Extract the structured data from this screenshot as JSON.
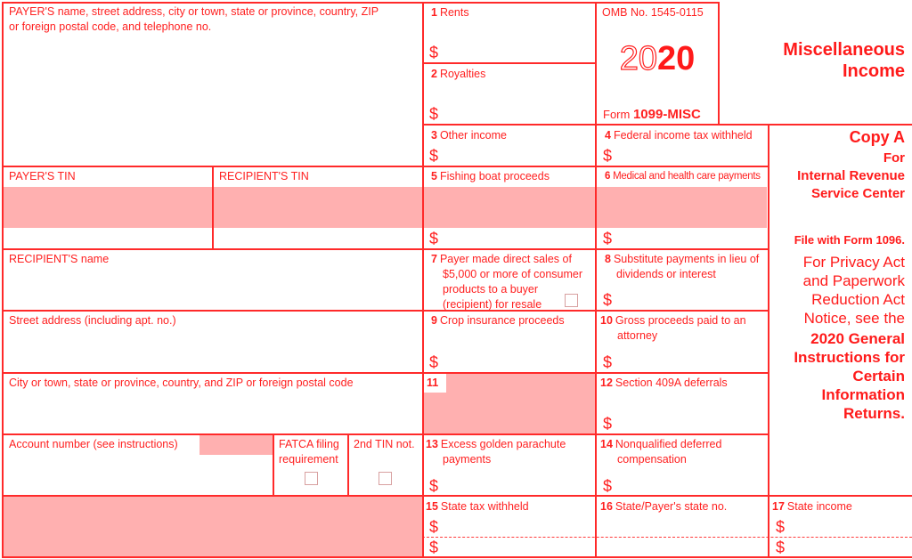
{
  "form": {
    "omb": "OMB No. 1545-0115",
    "year_outline": "20",
    "year_solid": "20",
    "form_prefix": "Form",
    "form_name": "1099-MISC",
    "title_line1": "Miscellaneous",
    "title_line2": "Income",
    "copy": "Copy A",
    "for_line1": "For",
    "for_line2": "Internal Revenue",
    "for_line3": "Service Center",
    "file_with": "File with Form 1096.",
    "privacy_lines": [
      "For Privacy Act",
      "and Paperwork",
      "Reduction Act",
      "Notice, see the"
    ],
    "instructions_lines": [
      "2020 General",
      "Instructions for",
      "Certain",
      "Information",
      "Returns."
    ],
    "colors": {
      "accent": "#ff1a1a",
      "shade": "#ffb0b0"
    }
  },
  "left": {
    "payer_name_l1": "PAYER'S name, street address, city or town, state or province, country, ZIP",
    "payer_name_l2": "or foreign postal code, and telephone no.",
    "payer_tin": "PAYER'S TIN",
    "recipient_tin": "RECIPIENT'S TIN",
    "recipient_name": "RECIPIENT'S name",
    "street": "Street address (including apt. no.)",
    "city": "City or town, state or province, country, and ZIP or foreign postal code",
    "account": "Account number (see instructions)",
    "fatca_l1": "FATCA filing",
    "fatca_l2": "requirement",
    "second_tin": "2nd TIN not."
  },
  "boxes": {
    "b1": {
      "num": "1",
      "label": "Rents"
    },
    "b2": {
      "num": "2",
      "label": "Royalties"
    },
    "b3": {
      "num": "3",
      "label": "Other income"
    },
    "b4": {
      "num": "4",
      "label": "Federal income tax withheld"
    },
    "b5": {
      "num": "5",
      "label": "Fishing boat proceeds"
    },
    "b6": {
      "num": "6",
      "label": "Medical and health care payments"
    },
    "b7": {
      "num": "7",
      "l1": "Payer made direct sales of",
      "l2": "$5,000 or more of consumer",
      "l3": "products to a buyer",
      "l4": "(recipient) for resale"
    },
    "b8": {
      "num": "8",
      "l1": "Substitute payments in lieu of",
      "l2": "dividends or interest"
    },
    "b9": {
      "num": "9",
      "label": "Crop insurance proceeds"
    },
    "b10": {
      "num": "10",
      "l1": "Gross proceeds paid to an",
      "l2": "attorney"
    },
    "b11": {
      "num": "11"
    },
    "b12": {
      "num": "12",
      "label": "Section 409A deferrals"
    },
    "b13": {
      "num": "13",
      "l1": "Excess golden parachute",
      "l2": "payments"
    },
    "b14": {
      "num": "14",
      "l1": "Nonqualified deferred",
      "l2": "compensation"
    },
    "b15": {
      "num": "15",
      "label": "State tax withheld"
    },
    "b16": {
      "num": "16",
      "label": "State/Payer's state no."
    },
    "b17": {
      "num": "17",
      "label": "State income"
    }
  },
  "currency_symbol": "$"
}
